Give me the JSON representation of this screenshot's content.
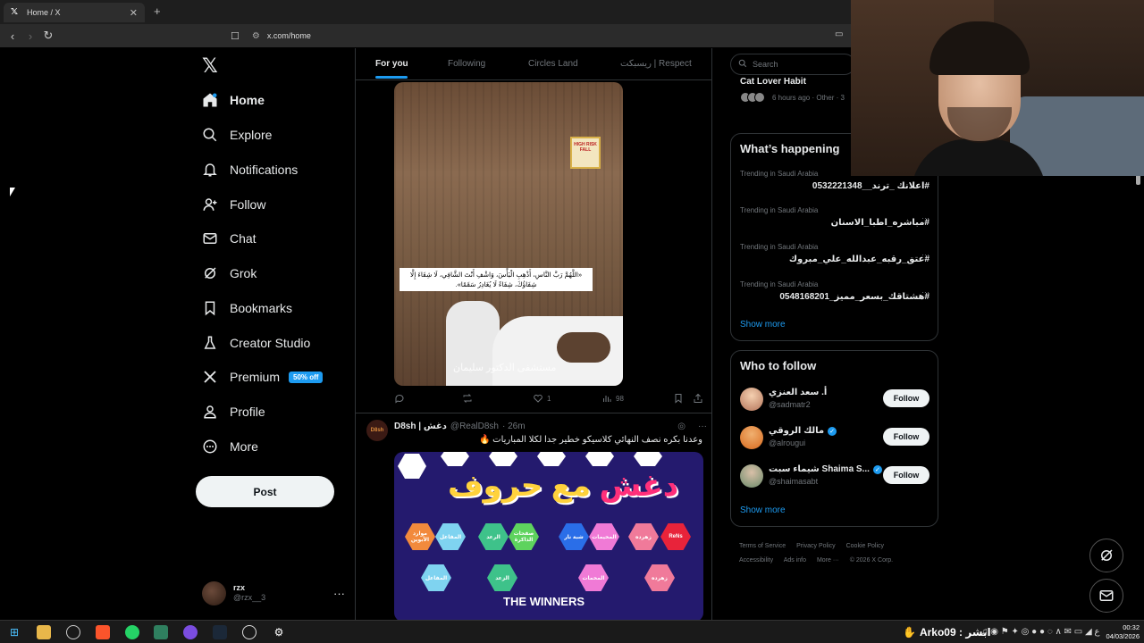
{
  "browser": {
    "tab_title": "Home / X",
    "new_tab": "+",
    "url": "x.com/home"
  },
  "nav": {
    "items": [
      {
        "label": "Home",
        "icon": "home-icon"
      },
      {
        "label": "Explore",
        "icon": "search-icon"
      },
      {
        "label": "Notifications",
        "icon": "bell-icon"
      },
      {
        "label": "Follow",
        "icon": "person-add-icon"
      },
      {
        "label": "Chat",
        "icon": "mail-icon"
      },
      {
        "label": "Grok",
        "icon": "grok-icon"
      },
      {
        "label": "Bookmarks",
        "icon": "bookmark-icon"
      },
      {
        "label": "Creator Studio",
        "icon": "flask-icon"
      },
      {
        "label": "Premium",
        "icon": "x-logo-icon"
      },
      {
        "label": "Profile",
        "icon": "person-icon"
      },
      {
        "label": "More",
        "icon": "more-circle-icon"
      }
    ],
    "premium_badge": "50% off",
    "post_button": "Post",
    "account": {
      "name": "rzx",
      "handle": "@rzx__3",
      "more": "···"
    }
  },
  "timeline": {
    "tabs": [
      "For you",
      "Following",
      "Circles Land",
      "ريسبكت | Respect"
    ],
    "post1": {
      "image_caption": "«اللَّهُمَّ رَبَّ النَّاسِ، أَذْهِبِ الْبَأْسَ، وَاشْفِ أَنْتَ الشَّافِي، لَا شِفَاءَ إِلَّا شِفَاؤُكَ، شِفَاءً لَا يُغَادِرُ سَقَمًا».",
      "watermark": "مستشفى الدكتور سليمان",
      "sticker": "HIGH RISK FALL",
      "likes": "1",
      "views": "98"
    },
    "post2": {
      "avatar_text": "D8sh",
      "name": "D8sh | دغش",
      "handle": "@RealD8sh",
      "time": "· 26m",
      "text": "وعدنا بكره نصف النهائي كلاسيكو خطير جدا لكلا المباريات 🔥",
      "image_title_a": "حروف",
      "image_title_b": "مع",
      "image_title_c": "دغش",
      "image_footer": "THE WINNERS",
      "hexes": [
        "موارد الأبوين",
        "المفاعل",
        "الرعد",
        "صفحات الذاكرة",
        "شبة نار",
        "المخيمات",
        "زهرده",
        "ReNs",
        "المفاعل",
        "الزعد",
        "المخمات",
        "زهرده"
      ]
    }
  },
  "sidebar": {
    "search_placeholder": "Search",
    "news_title": "Cat Lover Habit",
    "news_meta": "6 hours ago · Other · 3",
    "happening_title": "What’s happening",
    "trends": [
      {
        "context": "Trending in Saudi Arabia",
        "tag": "#اعلانك _ترند__0532221348"
      },
      {
        "context": "Trending in Saudi Arabia",
        "tag": "#مباشره_اطبا_الاسنان"
      },
      {
        "context": "Trending in Saudi Arabia",
        "tag": "#عتق_رقبه_عبدالله_علي_مبروك"
      },
      {
        "context": "Trending in Saudi Arabia",
        "tag": "#هشتاقك_بسعر_مميز_0548168201"
      }
    ],
    "show_more": "Show more",
    "who_title": "Who to follow",
    "users": [
      {
        "name": "أ. سعد العنزي",
        "handle": "@sadmatr2",
        "verified": false
      },
      {
        "name": "مالك الروقي",
        "handle": "@alrougui",
        "verified": true
      },
      {
        "name": "شيماء سبت Shaima S...",
        "handle": "@shaimasabt",
        "verified": true
      }
    ],
    "follow_label": "Follow",
    "footer": [
      "Terms of Service",
      "Privacy Policy",
      "Cookie Policy",
      "Accessibility",
      "Ads info",
      "More ···",
      "© 2026 X Corp."
    ]
  },
  "taskbar": {
    "tray_text": "Arko09 : ابشر",
    "time": "00:32",
    "date": "04/03/2026"
  },
  "colors": {
    "accent": "#1d9bf0",
    "background": "#000000",
    "border": "#2f3336",
    "muted": "#71767b"
  }
}
